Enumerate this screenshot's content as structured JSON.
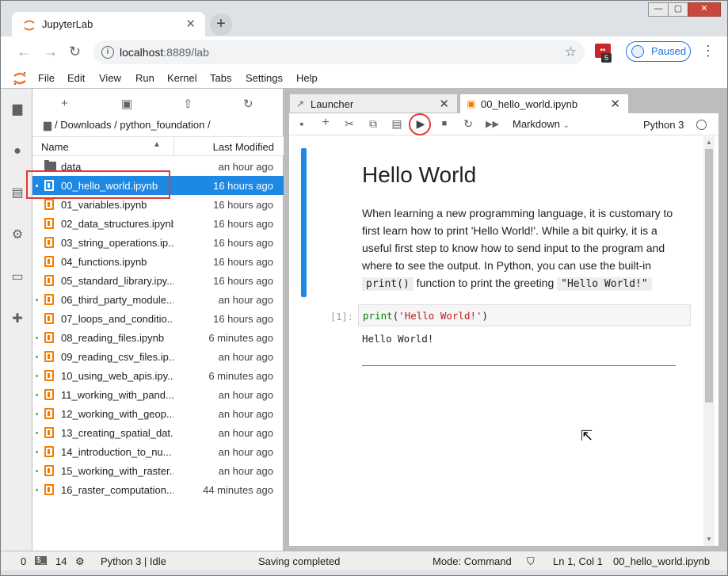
{
  "browser": {
    "tab_title": "JupyterLab",
    "tab_close": "✕",
    "new_tab": "+",
    "url_host": "localhost",
    "url_path": ":8889/lab",
    "profile_status": "Paused",
    "extension_badge": "5"
  },
  "menu": [
    "File",
    "Edit",
    "View",
    "Run",
    "Kernel",
    "Tabs",
    "Settings",
    "Help"
  ],
  "filebrowser": {
    "breadcrumb": "/ Downloads / python_foundation /",
    "col_name": "Name",
    "col_modified": "Last Modified",
    "files": [
      {
        "name": "data",
        "modified": "an hour ago",
        "type": "folder",
        "running": false,
        "selected": false
      },
      {
        "name": "00_hello_world.ipynb",
        "modified": "16 hours ago",
        "type": "notebook",
        "running": true,
        "selected": true
      },
      {
        "name": "01_variables.ipynb",
        "modified": "16 hours ago",
        "type": "notebook",
        "running": false,
        "selected": false
      },
      {
        "name": "02_data_structures.ipynb",
        "modified": "16 hours ago",
        "type": "notebook",
        "running": false,
        "selected": false
      },
      {
        "name": "03_string_operations.ip...",
        "modified": "16 hours ago",
        "type": "notebook",
        "running": false,
        "selected": false
      },
      {
        "name": "04_functions.ipynb",
        "modified": "16 hours ago",
        "type": "notebook",
        "running": false,
        "selected": false
      },
      {
        "name": "05_standard_library.ipy...",
        "modified": "16 hours ago",
        "type": "notebook",
        "running": false,
        "selected": false
      },
      {
        "name": "06_third_party_module...",
        "modified": "an hour ago",
        "type": "notebook",
        "running": true,
        "selected": false
      },
      {
        "name": "07_loops_and_conditio...",
        "modified": "16 hours ago",
        "type": "notebook",
        "running": false,
        "selected": false
      },
      {
        "name": "08_reading_files.ipynb",
        "modified": "6 minutes ago",
        "type": "notebook",
        "running": true,
        "selected": false
      },
      {
        "name": "09_reading_csv_files.ip...",
        "modified": "an hour ago",
        "type": "notebook",
        "running": true,
        "selected": false
      },
      {
        "name": "10_using_web_apis.ipy...",
        "modified": "6 minutes ago",
        "type": "notebook",
        "running": true,
        "selected": false
      },
      {
        "name": "11_working_with_pand...",
        "modified": "an hour ago",
        "type": "notebook",
        "running": true,
        "selected": false
      },
      {
        "name": "12_working_with_geop...",
        "modified": "an hour ago",
        "type": "notebook",
        "running": true,
        "selected": false
      },
      {
        "name": "13_creating_spatial_dat...",
        "modified": "an hour ago",
        "type": "notebook",
        "running": true,
        "selected": false
      },
      {
        "name": "14_introduction_to_nu...",
        "modified": "an hour ago",
        "type": "notebook",
        "running": true,
        "selected": false
      },
      {
        "name": "15_working_with_raster...",
        "modified": "an hour ago",
        "type": "notebook",
        "running": true,
        "selected": false
      },
      {
        "name": "16_raster_computation...",
        "modified": "44 minutes ago",
        "type": "notebook",
        "running": true,
        "selected": false
      }
    ]
  },
  "doc_tabs": {
    "launcher": "Launcher",
    "notebook": "00_hello_world.ipynb"
  },
  "notebook": {
    "cell_type": "Markdown",
    "kernel": "Python 3",
    "heading": "Hello World",
    "para_1": "When learning a new programming language, it is customary to first learn how to print 'Hello World!'. While a bit quirky, it is a useful first step to know how to send input to the program and where to see the output. In Python, you can use the built-in ",
    "code_print": "print()",
    "para_2": " function to print the greeting ",
    "code_greeting": "\"Hello World!\"",
    "prompt": "[1]:",
    "code_fn": "print",
    "code_open": "(",
    "code_str": "'Hello World!'",
    "code_close": ")",
    "output": "Hello World!"
  },
  "statusbar": {
    "terminals": "0",
    "kernels": "14",
    "kernel_status": "Python 3 | Idle",
    "message": "Saving completed",
    "mode": "Mode: Command",
    "position": "Ln 1, Col 1",
    "filename": "00_hello_world.ipynb"
  },
  "colors": {
    "accent": "#1e88e5",
    "notebook_icon": "#f57c00",
    "highlight_box": "#e53935"
  }
}
